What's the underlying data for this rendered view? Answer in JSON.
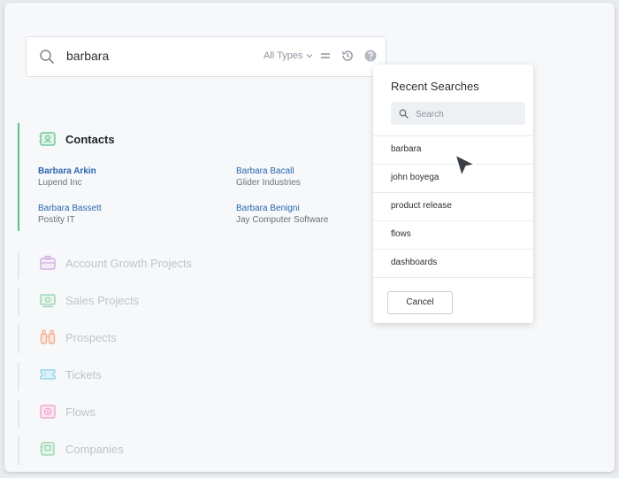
{
  "search": {
    "query": "barbara",
    "type_filter": "All Types",
    "icon": "search-icon"
  },
  "toolbar": {
    "filter_icon": "filter-icon",
    "history_icon": "history-icon",
    "help_icon": "help-icon"
  },
  "groups": [
    {
      "title": "Contacts",
      "icon": "contact-card-icon",
      "color": "#58c28a"
    },
    {
      "title": "Account Growth Projects",
      "icon": "briefcase-icon",
      "color": "#c9a3e0"
    },
    {
      "title": "Sales Projects",
      "icon": "money-icon",
      "color": "#8fd1a8"
    },
    {
      "title": "Prospects",
      "icon": "binoculars-icon",
      "color": "#f2a87e"
    },
    {
      "title": "Tickets",
      "icon": "ticket-icon",
      "color": "#8cd0ef"
    },
    {
      "title": "Flows",
      "icon": "flow-icon",
      "color": "#ee9cc6"
    },
    {
      "title": "Companies",
      "icon": "building-icon",
      "color": "#8fd1a8"
    }
  ],
  "contacts": [
    {
      "name": "Barbara Arkin",
      "org": "Lupend Inc"
    },
    {
      "name": "Barbara Bacall",
      "org": "Glider Industries"
    },
    {
      "name": "Barbara Bassett",
      "org": "Postity IT"
    },
    {
      "name": "Barbara Benigni",
      "org": "Jay Computer Software"
    }
  ],
  "recent_panel": {
    "title": "Recent Searches",
    "search_placeholder": "Search",
    "items": [
      "barbara",
      "john boyega",
      "product release",
      "flows",
      "dashboards"
    ],
    "cancel_label": "Cancel"
  }
}
